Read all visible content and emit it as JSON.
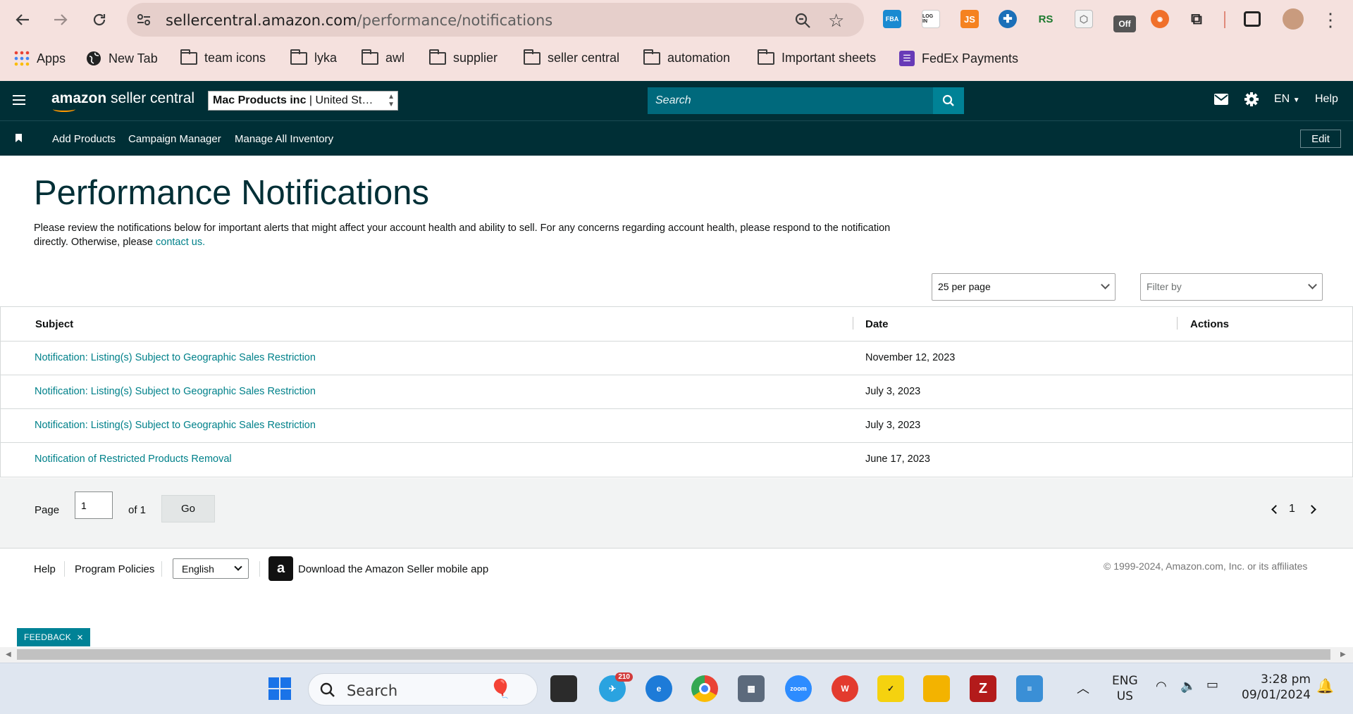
{
  "browser": {
    "url_host": "sellercentral.amazon.com",
    "url_path": "/performance/notifications",
    "bookmarks": [
      {
        "label": "Apps",
        "icon": "apps-grid-icon"
      },
      {
        "label": "New Tab",
        "icon": "globe-icon"
      },
      {
        "label": "team icons",
        "icon": "folder-icon"
      },
      {
        "label": "lyka",
        "icon": "folder-icon"
      },
      {
        "label": "awl",
        "icon": "folder-icon"
      },
      {
        "label": "supplier",
        "icon": "folder-icon"
      },
      {
        "label": "seller central",
        "icon": "folder-icon"
      },
      {
        "label": "automation",
        "icon": "folder-icon"
      },
      {
        "label": "Important sheets",
        "icon": "folder-icon"
      },
      {
        "label": "FedEx Payments",
        "icon": "form-icon"
      }
    ],
    "extensions": {
      "fba": "FBA",
      "login": "LOG IN",
      "js": "JS",
      "rs": "RS",
      "off": "Off"
    }
  },
  "header": {
    "logo_bold": "amazon",
    "logo_rest": " seller central",
    "store_name": "Mac Products inc",
    "store_region": " | United St…",
    "search_placeholder": "Search",
    "language": "EN",
    "help": "Help"
  },
  "subnav": {
    "items": [
      "Add Products",
      "Campaign Manager",
      "Manage All Inventory"
    ],
    "edit_label": "Edit"
  },
  "main": {
    "title": "Performance Notifications",
    "intro_text": "Please review the notifications below for important alerts that might affect your account health and ability to sell. For any concerns regarding account health, please respond to the notification directly. Otherwise, please ",
    "contact_link": "contact us.",
    "per_page": "25 per page",
    "filter_placeholder": "Filter by"
  },
  "table": {
    "columns": [
      "Subject",
      "Date",
      "Actions"
    ],
    "rows": [
      {
        "subject": "Notification: Listing(s) Subject to Geographic Sales Restriction",
        "date": "November 12, 2023"
      },
      {
        "subject": "Notification: Listing(s) Subject to Geographic Sales Restriction",
        "date": "July 3, 2023"
      },
      {
        "subject": "Notification: Listing(s) Subject to Geographic Sales Restriction",
        "date": "July 3, 2023"
      },
      {
        "subject": "Notification of Restricted Products Removal",
        "date": "June 17, 2023"
      }
    ]
  },
  "pager": {
    "page_label": "Page",
    "page_value": "1",
    "of_label": "of 1",
    "go_label": "Go",
    "current_page": "1"
  },
  "footer": {
    "help": "Help",
    "program_policies": "Program Policies",
    "language": "English",
    "app_icon_glyph": "a",
    "download_app": "Download the Amazon Seller mobile app",
    "copyright": "© 1999-2024, Amazon.com, Inc. or its affiliates"
  },
  "feedback": {
    "label": "FEEDBACK",
    "close": "×"
  },
  "taskbar": {
    "search_label": "Search",
    "telegram_badge": "210",
    "zoom_label": "zoom",
    "lang_top": "ENG",
    "lang_bottom": "US",
    "time": "3:28 pm",
    "date": "09/01/2024"
  },
  "colors": {
    "header_bg": "#002f36",
    "link": "#00818a",
    "search_bg": "#00697c",
    "feedback_bg": "#008296"
  }
}
